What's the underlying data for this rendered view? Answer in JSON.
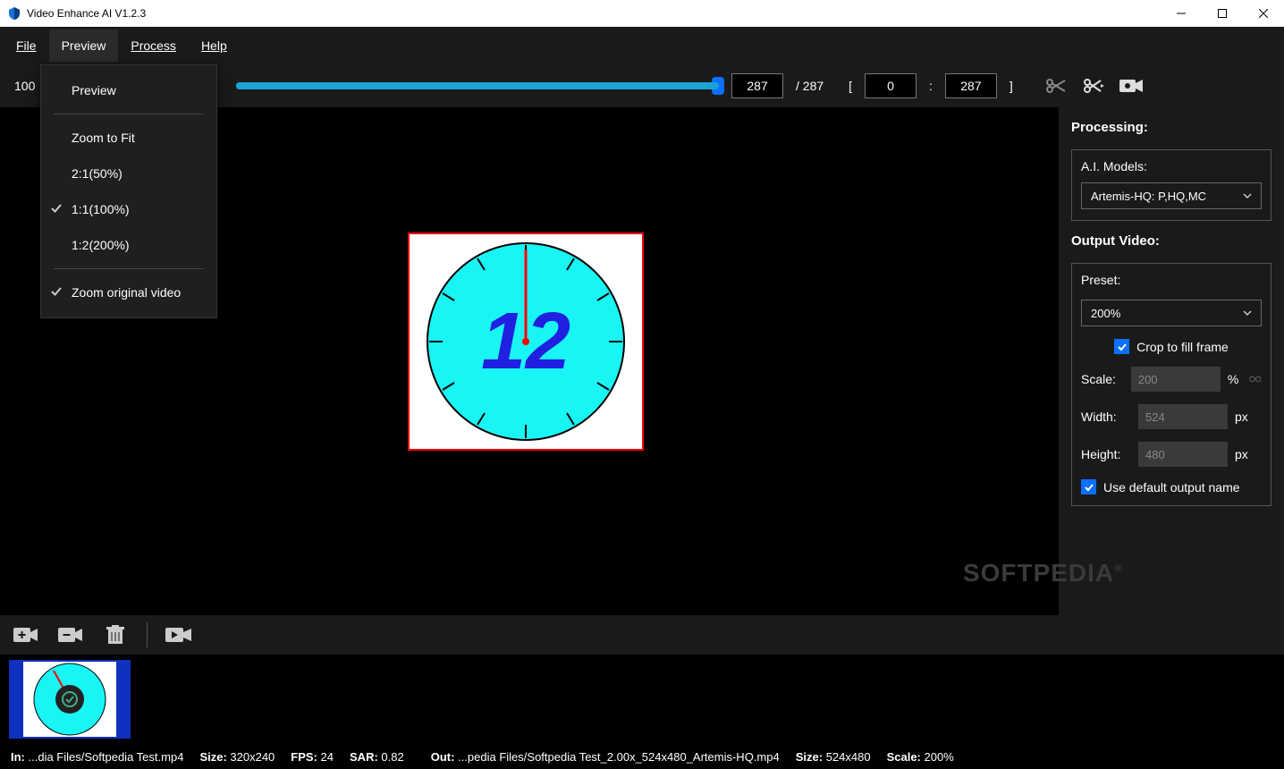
{
  "title": "Video Enhance AI V1.2.3",
  "menu": {
    "file": "File",
    "preview": "Preview",
    "process": "Process",
    "help": "Help"
  },
  "previewMenu": {
    "preview": "Preview",
    "zoomFit": "Zoom to Fit",
    "z50": "2:1(50%)",
    "z100": "1:1(100%)",
    "z200": "1:2(200%)",
    "zoomOrig": "Zoom original video"
  },
  "toolbar": {
    "zoom": "100",
    "currentFrame": "287",
    "totalFrames": "287",
    "startFrame": "0",
    "endFrame": "287",
    "bracketL": "[",
    "colon": ":",
    "bracketR": "]",
    "slash": "/ "
  },
  "right": {
    "processing": "Processing:",
    "aiModels": "A.I. Models:",
    "model": "Artemis-HQ: P,HQ,MC",
    "outputVideo": "Output Video:",
    "preset": "Preset:",
    "presetVal": "200%",
    "cropFill": "Crop to fill frame",
    "scale": "Scale:",
    "scaleVal": "200",
    "pct": "%",
    "width": "Width:",
    "widthVal": "524",
    "px": "px",
    "height": "Height:",
    "heightVal": "480",
    "defaultName": "Use default output name"
  },
  "watermark": "SOFTPEDIA",
  "status": {
    "inLabel": "In:",
    "inVal": "...dia Files/Softpedia Test.mp4",
    "size1Label": "Size:",
    "size1": "320x240",
    "fpsLabel": "FPS:",
    "fps": "24",
    "sarLabel": "SAR:",
    "sar": "0.82",
    "outLabel": "Out:",
    "outVal": "...pedia Files/Softpedia Test_2.00x_524x480_Artemis-HQ.mp4",
    "size2Label": "Size:",
    "size2": "524x480",
    "scaleLabel": "Scale:",
    "scale": "200%"
  },
  "clockNumeral": "12"
}
